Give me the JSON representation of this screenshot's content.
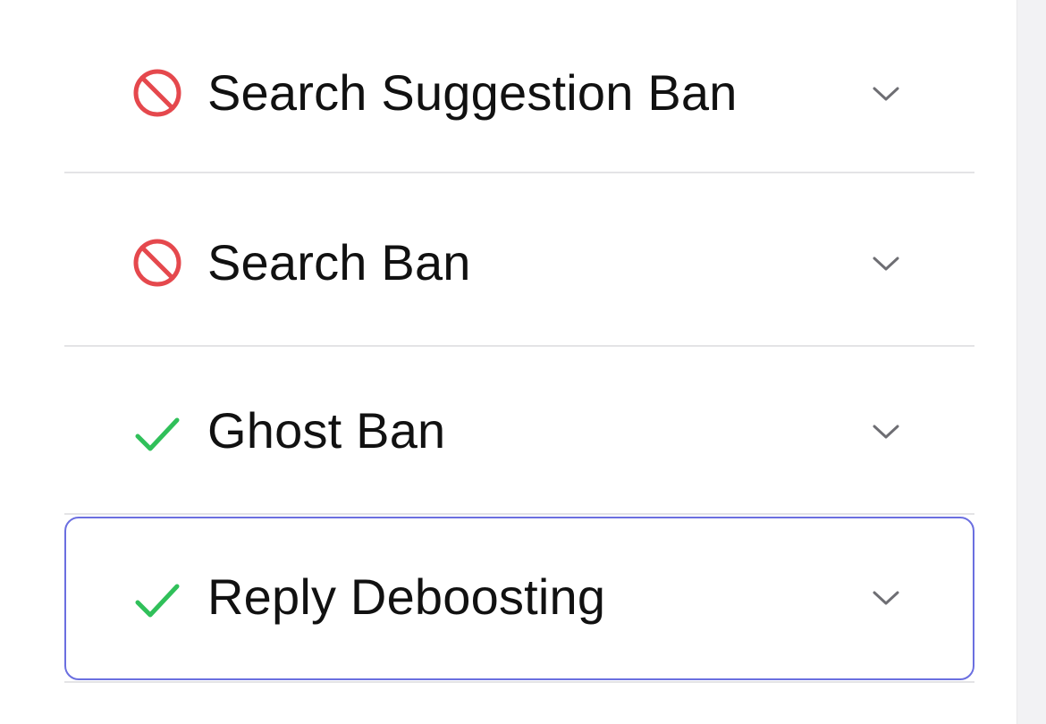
{
  "colors": {
    "ban_red": "#e5484d",
    "check_green": "#30c05a",
    "chevron_gray": "#6e6e73",
    "focus_ring": "#6b6fe0",
    "divider": "#e4e4e6"
  },
  "items": [
    {
      "label": "Search Suggestion Ban",
      "status": "banned",
      "icon": "prohibited-icon",
      "expanded": false
    },
    {
      "label": "Search Ban",
      "status": "banned",
      "icon": "prohibited-icon",
      "expanded": false
    },
    {
      "label": "Ghost Ban",
      "status": "clear",
      "icon": "checkmark-icon",
      "expanded": false
    },
    {
      "label": "Reply Deboosting",
      "status": "clear",
      "icon": "checkmark-icon",
      "expanded": false,
      "focused": true
    }
  ]
}
